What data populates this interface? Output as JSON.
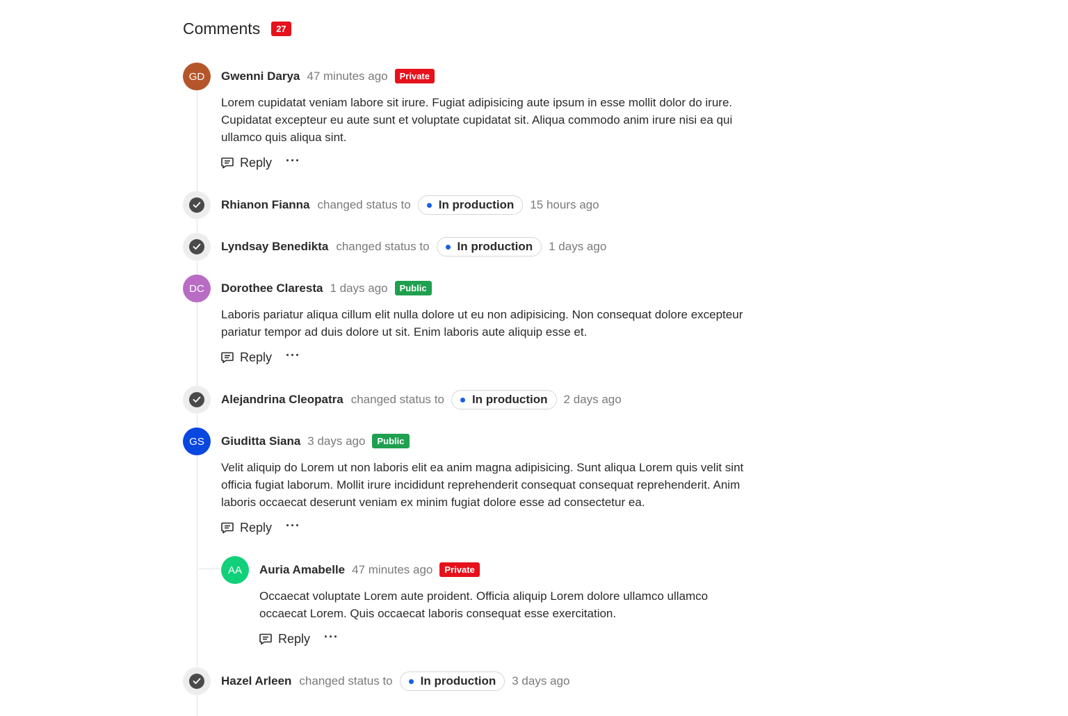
{
  "header": {
    "title": "Comments",
    "count": "27"
  },
  "actions": {
    "reply": "Reply",
    "more": "···"
  },
  "status_change_text": "changed status to",
  "comments": [
    {
      "initials": "GD",
      "avatar_color": "#b5562a",
      "name": "Gwenni Darya",
      "time": "47 minutes ago",
      "visibility": "Private",
      "lines": [
        "Lorem cupidatat veniam labore sit irure. Fugiat adipisicing aute ipsum in esse mollit dolor do irure.",
        "Cupidatat excepteur eu aute sunt et voluptate cupidatat sit. Aliqua commodo anim irure nisi ea qui",
        "ullamco quis aliqua sint."
      ]
    },
    {
      "initials": "DC",
      "avatar_color": "#b86cc4",
      "name": "Dorothee Claresta",
      "time": "1 days ago",
      "visibility": "Public",
      "lines": [
        "Laboris pariatur aliqua cillum elit nulla dolore ut eu non adipisicing. Non consequat dolore excepteur",
        "pariatur tempor ad duis dolore ut sit. Enim laboris aute aliquip esse et."
      ]
    },
    {
      "initials": "GS",
      "avatar_color": "#0a47e0",
      "name": "Giuditta Siana",
      "time": "3 days ago",
      "visibility": "Public",
      "lines": [
        "Velit aliquip do Lorem ut non laboris elit ea anim magna adipisicing. Sunt aliqua Lorem quis velit sint",
        "officia fugiat laborum. Mollit irure incididunt reprehenderit consequat consequat reprehenderit. Anim",
        "laboris occaecat deserunt veniam ex minim fugiat dolore esse ad consectetur ea."
      ]
    },
    {
      "initials": "AA",
      "avatar_color": "#10d07a",
      "name": "Auria Amabelle",
      "time": "47 minutes ago",
      "visibility": "Private",
      "lines": [
        "Occaecat voluptate Lorem aute proident. Officia aliquip Lorem dolore ullamco ullamco",
        "occaecat Lorem. Quis occaecat laboris consequat esse exercitation."
      ]
    }
  ],
  "status_changes": [
    {
      "name": "Rhianon Fianna",
      "status": "In production",
      "time": "15 hours ago"
    },
    {
      "name": "Lyndsay Benedikta",
      "status": "In production",
      "time": "1 days ago"
    },
    {
      "name": "Alejandrina Cleopatra",
      "status": "In production",
      "time": "2 days ago"
    },
    {
      "name": "Hazel Arleen",
      "status": "In production",
      "time": "3 days ago"
    }
  ]
}
